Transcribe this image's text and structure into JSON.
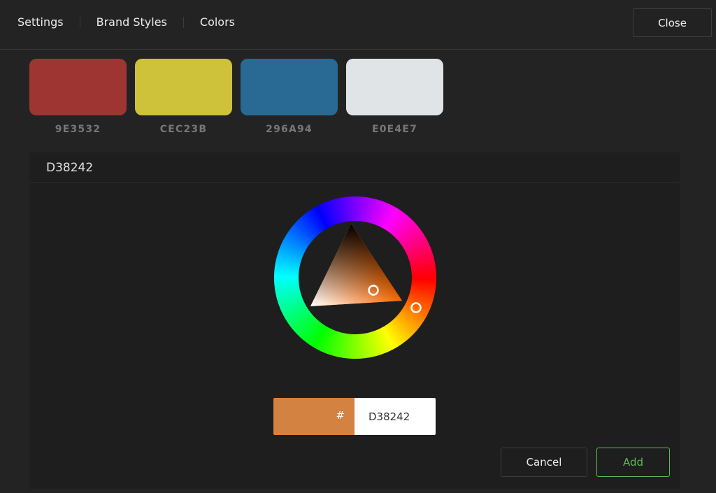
{
  "header": {
    "breadcrumbs": [
      "Settings",
      "Brand Styles",
      "Colors"
    ],
    "close_label": "Close"
  },
  "swatches": [
    {
      "hex": "9E3532",
      "color": "#9E3532"
    },
    {
      "hex": "CEC23B",
      "color": "#CEC23B"
    },
    {
      "hex": "296A94",
      "color": "#296A94"
    },
    {
      "hex": "E0E4E7",
      "color": "#E0E4E7"
    }
  ],
  "picker": {
    "title": "D38242",
    "current_color": "#D38242",
    "hue_color": "#FF6A00",
    "hash_symbol": "#",
    "hex_value": "D38242",
    "cancel_label": "Cancel",
    "add_label": "Add",
    "accent": "#5CB85C"
  }
}
